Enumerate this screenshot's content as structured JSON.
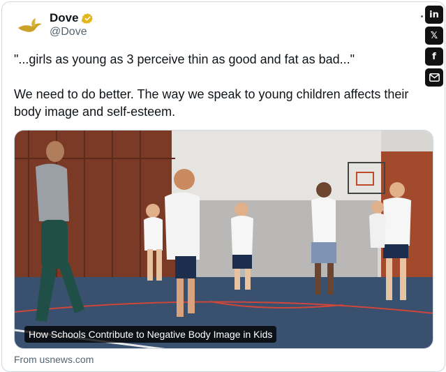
{
  "tweet": {
    "author_name": "Dove",
    "author_handle": "@Dove",
    "paragraphs": [
      "\"...girls as young as 3 perceive thin as good and fat as bad...\"",
      "We need to do better. The way we speak to young children affects their body image and self-esteem."
    ]
  },
  "media": {
    "caption": "How Schools Contribute to Negative Body Image in Kids",
    "source": "From usnews.com"
  },
  "share": {
    "linkedin_label": "in",
    "x_label": "𝕏",
    "facebook_label": "f"
  },
  "colors": {
    "verified_gold": "#e2b719",
    "dove_gold": "#c9a227",
    "text_primary": "#0f1419",
    "text_secondary": "#536471",
    "share_bg": "#111111"
  },
  "icons": [
    "dove-logo-icon",
    "verified-badge-icon",
    "linkedin-icon",
    "x-icon",
    "facebook-icon",
    "email-icon"
  ]
}
